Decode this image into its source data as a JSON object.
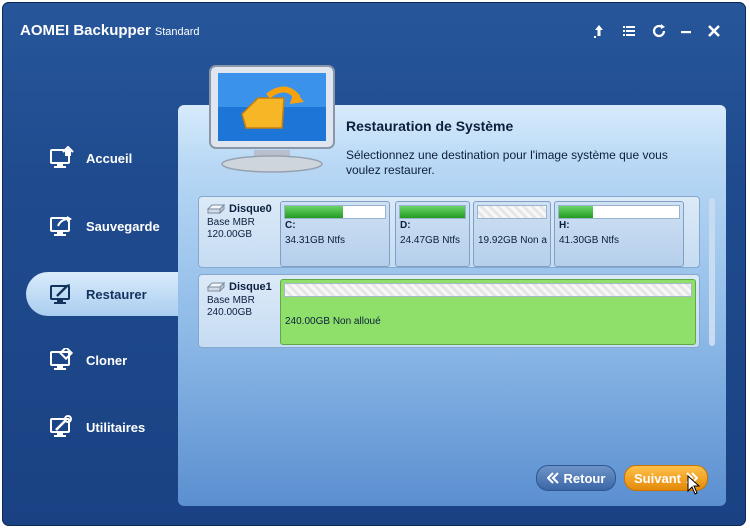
{
  "app": {
    "title": "AOMEI Backupper",
    "edition": "Standard"
  },
  "window_controls": [
    "upgrade-icon",
    "menu-icon",
    "refresh-icon",
    "minimize-icon",
    "close-icon"
  ],
  "sidebar": {
    "items": [
      {
        "label": "Accueil",
        "icon": "home-icon",
        "active": false
      },
      {
        "label": "Sauvegarde",
        "icon": "backup-icon",
        "active": false
      },
      {
        "label": "Restaurer",
        "icon": "restore-icon",
        "active": true
      },
      {
        "label": "Cloner",
        "icon": "clone-icon",
        "active": false
      },
      {
        "label": "Utilitaires",
        "icon": "tools-icon",
        "active": false
      }
    ]
  },
  "main": {
    "heading": "Restauration de Système",
    "description": "Sélectionnez une destination pour l'image système que vous voulez restaurer."
  },
  "disks": [
    {
      "name": "Disque0",
      "type": "Base MBR",
      "size": "120.00GB",
      "partitions": [
        {
          "letter": "C:",
          "info": "34.31GB Ntfs",
          "used_fraction": 0.58
        },
        {
          "letter": "D:",
          "info": "24.47GB Ntfs",
          "used_fraction": 1.0
        },
        {
          "letter": "",
          "info": "19.92GB Non a",
          "used_fraction": 0
        },
        {
          "letter": "H:",
          "info": "41.30GB Ntfs",
          "used_fraction": 0.28
        }
      ]
    },
    {
      "name": "Disque1",
      "type": "Base MBR",
      "size": "240.00GB",
      "partitions": [
        {
          "letter": "",
          "info": "240.00GB Non alloué",
          "used_fraction": 0
        }
      ]
    }
  ],
  "buttons": {
    "back": "Retour",
    "next": "Suivant"
  },
  "colors": {
    "accent": "#e48a09",
    "used_bar": "#239c22",
    "selected_partition": "#8fe06b"
  }
}
